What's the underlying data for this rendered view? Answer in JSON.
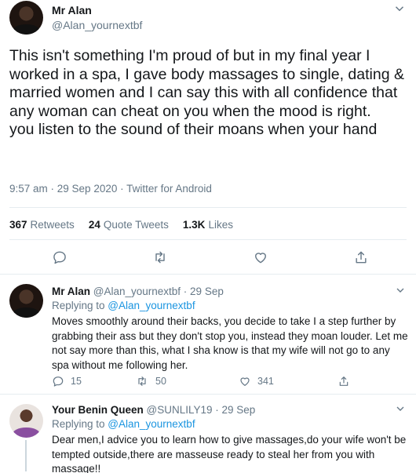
{
  "main_tweet": {
    "name": "Mr Alan",
    "handle": "@Alan_yournextbf",
    "text": "This isn't something I'm proud of but in my final year I worked in a spa, I gave body massages to single, dating & married women and I can say this with all confidence that any woman can cheat on you when the mood is right.\nyou listen to the sound of their moans when your hand",
    "meta": "9:57 am · 29 Sep 2020 · Twitter for Android",
    "stats": {
      "retweets_count": "367",
      "retweets_label": "Retweets",
      "quotes_count": "24",
      "quotes_label": "Quote Tweets",
      "likes_count": "1.3K",
      "likes_label": "Likes"
    }
  },
  "replies": [
    {
      "name": "Mr Alan",
      "handle": "@Alan_yournextbf · 29 Sep",
      "replying_prefix": "Replying to ",
      "replying_to": "@Alan_yournextbf",
      "text": "Moves smoothly around their backs, you decide to take I a step further by grabbing their ass but they don't stop you, instead they moan louder. Let me not say more than this, what I sha know is that my wife will not go to any spa without me following her.",
      "reply_count": "15",
      "retweet_count": "50",
      "like_count": "341"
    },
    {
      "name": "Your Benin Queen",
      "handle": "@SUNLILY19 · 29 Sep",
      "replying_prefix": "Replying to ",
      "replying_to": "@Alan_yournextbf",
      "text": "Dear men,I advice you to learn how to give massages,do your wife won't be tempted outside,there are masseuse ready to steal her from you with massage!!"
    }
  ],
  "colors": {
    "accent": "#1b95e0",
    "muted": "#657786",
    "text": "#14171a",
    "divider": "#e6ecf0"
  },
  "icons": [
    "reply-icon",
    "retweet-icon",
    "like-icon",
    "share-icon",
    "more-icon"
  ]
}
